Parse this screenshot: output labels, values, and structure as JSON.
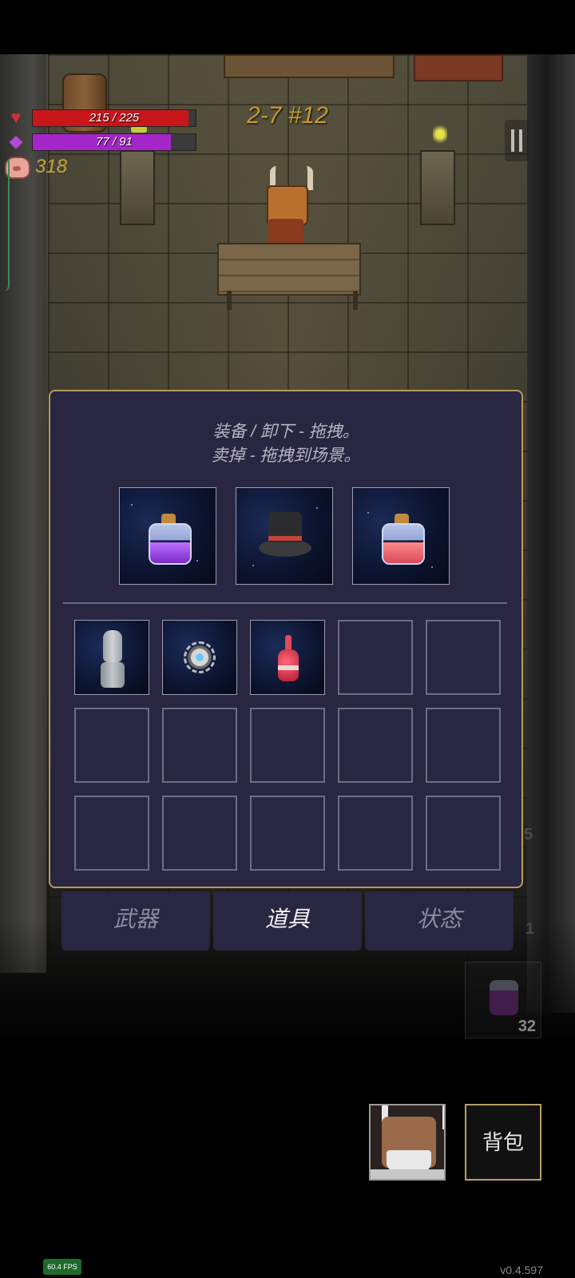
{
  "hud": {
    "hp_text": "215 / 225",
    "hp_current": 215,
    "hp_max": 225,
    "mp_text": "77 / 91",
    "mp_current": 77,
    "mp_max": 91,
    "coins": "318",
    "level": "2-7 #12",
    "colors": {
      "hp": "#c8161a",
      "mp": "#a526c8",
      "coins": "#c9a233",
      "level": "#c99a32"
    }
  },
  "inventory": {
    "hint_line1": "装备 / 卸下 - 拖拽。",
    "hint_line2": "卖掉 - 拖拽到场景。",
    "equipped": [
      {
        "icon": "purple-potion-icon"
      },
      {
        "icon": "top-hat-icon"
      },
      {
        "icon": "red-potion-icon"
      }
    ],
    "items": [
      {
        "icon": "stone-statue-icon"
      },
      {
        "icon": "gear-orb-icon"
      },
      {
        "icon": "red-flask-icon"
      }
    ]
  },
  "tabs": [
    {
      "label": "武器",
      "active": false
    },
    {
      "label": "道具",
      "active": true
    },
    {
      "label": "状态",
      "active": false
    }
  ],
  "quick_slot": {
    "count": "32",
    "icon": "potion-icon"
  },
  "side_digits": [
    "5",
    "1"
  ],
  "backpack_label": "背包",
  "fps": "60.4 FPS",
  "version": "v0.4.597"
}
